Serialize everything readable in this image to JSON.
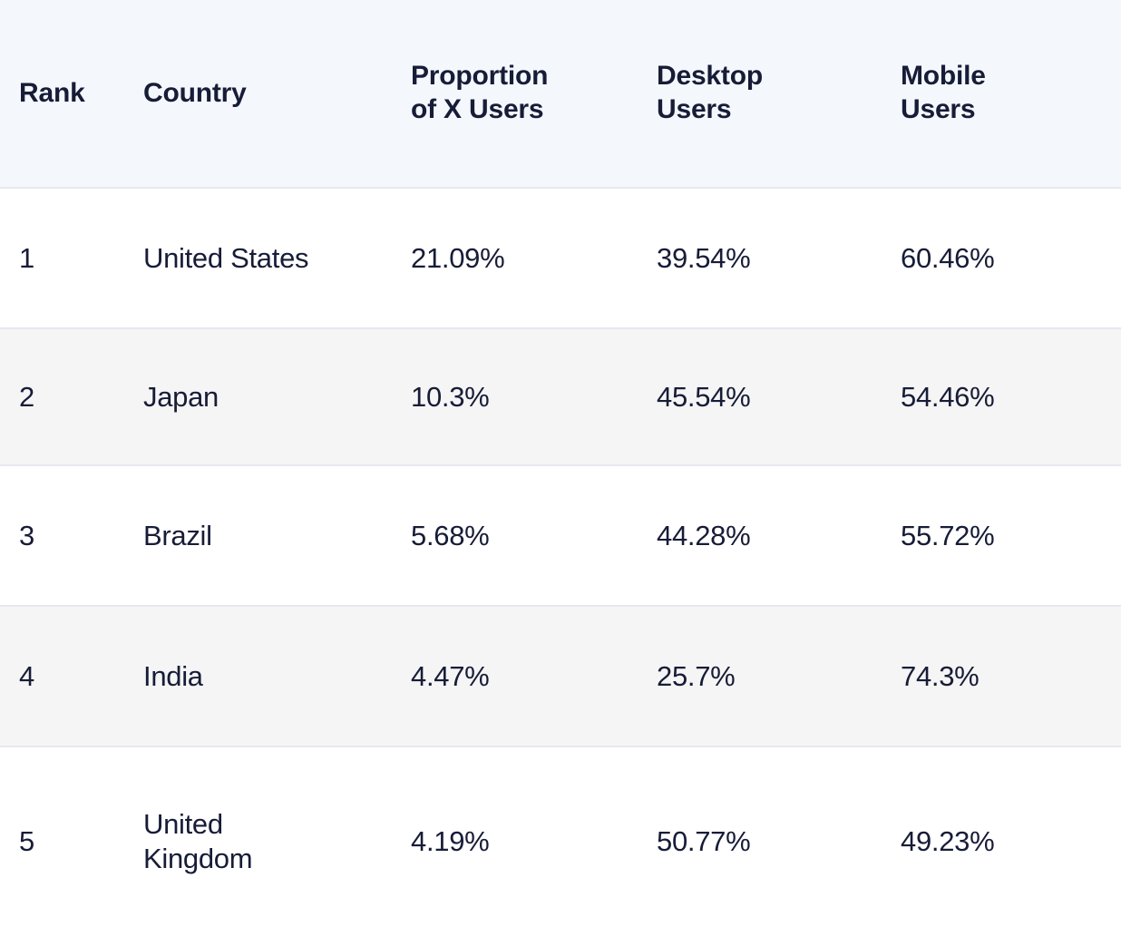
{
  "table": {
    "columns": [
      {
        "key": "rank",
        "label": "Rank",
        "lines": [
          "Rank"
        ]
      },
      {
        "key": "country",
        "label": "Country",
        "lines": [
          "Country"
        ]
      },
      {
        "key": "proportion",
        "label": "Proportion of X Users",
        "lines": [
          "Proportion",
          "of X Users"
        ]
      },
      {
        "key": "desktop",
        "label": "Desktop Users",
        "lines": [
          "Desktop",
          "Users"
        ]
      },
      {
        "key": "mobile",
        "label": "Mobile Users",
        "lines": [
          "Mobile",
          "Users"
        ]
      }
    ],
    "rows": [
      {
        "rank": "1",
        "country": "United States",
        "country_lines": [
          "United States"
        ],
        "proportion": "21.09%",
        "desktop": "39.54%",
        "mobile": "60.46%"
      },
      {
        "rank": "2",
        "country": "Japan",
        "country_lines": [
          "Japan"
        ],
        "proportion": "10.3%",
        "desktop": "45.54%",
        "mobile": "54.46%"
      },
      {
        "rank": "3",
        "country": "Brazil",
        "country_lines": [
          "Brazil"
        ],
        "proportion": "5.68%",
        "desktop": "44.28%",
        "mobile": "55.72%"
      },
      {
        "rank": "4",
        "country": "India",
        "country_lines": [
          "India"
        ],
        "proportion": "4.47%",
        "desktop": "25.7%",
        "mobile": "74.3%"
      },
      {
        "rank": "5",
        "country": "United Kingdom",
        "country_lines": [
          "United",
          "Kingdom"
        ],
        "proportion": "4.19%",
        "desktop": "50.77%",
        "mobile": "49.23%"
      }
    ]
  },
  "chart_data": {
    "type": "table",
    "title": "Proportion of X Users by Country",
    "columns": [
      "Rank",
      "Country",
      "Proportion of X Users",
      "Desktop Users",
      "Mobile Users"
    ],
    "rows": [
      [
        "1",
        "United States",
        "21.09%",
        "39.54%",
        "60.46%"
      ],
      [
        "2",
        "Japan",
        "10.3%",
        "45.54%",
        "54.46%"
      ],
      [
        "3",
        "Brazil",
        "5.68%",
        "44.28%",
        "55.72%"
      ],
      [
        "4",
        "India",
        "4.47%",
        "25.7%",
        "74.3%"
      ],
      [
        "5",
        "United Kingdom",
        "4.19%",
        "50.77%",
        "49.23%"
      ]
    ],
    "series": [
      {
        "name": "Proportion of X Users",
        "values": [
          21.09,
          10.3,
          5.68,
          4.47,
          4.19
        ]
      },
      {
        "name": "Desktop Users",
        "values": [
          39.54,
          45.54,
          44.28,
          25.7,
          50.77
        ]
      },
      {
        "name": "Mobile Users",
        "values": [
          60.46,
          54.46,
          55.72,
          74.3,
          49.23
        ]
      }
    ],
    "categories": [
      "United States",
      "Japan",
      "Brazil",
      "India",
      "United Kingdom"
    ],
    "units": "percent"
  },
  "style": {
    "header_bg": "#f4f8fd",
    "stripe_bg": "#f5f5f5",
    "row_bg": "#ffffff",
    "text_color": "#171c37",
    "border_color": "#e6e8ef"
  }
}
